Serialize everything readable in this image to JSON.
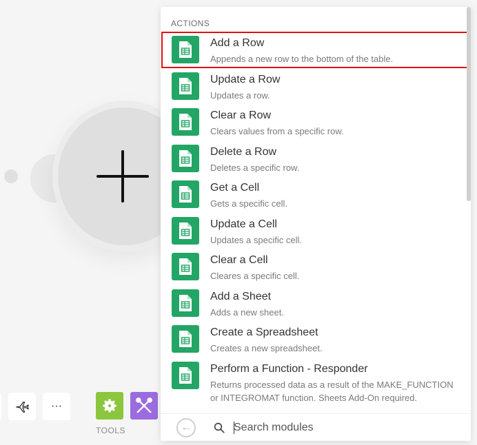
{
  "panel": {
    "section_title": "ACTIONS",
    "items": [
      {
        "title": "Add a Row",
        "desc": "Appends a new row to the bottom of the table."
      },
      {
        "title": "Update a Row",
        "desc": "Updates a row."
      },
      {
        "title": "Clear a Row",
        "desc": "Clears values from a specific row."
      },
      {
        "title": "Delete a Row",
        "desc": "Deletes a specific row."
      },
      {
        "title": "Get a Cell",
        "desc": "Gets a specific cell."
      },
      {
        "title": "Update a Cell",
        "desc": "Updates a specific cell."
      },
      {
        "title": "Clear a Cell",
        "desc": "Cleares a specific cell."
      },
      {
        "title": "Add a Sheet",
        "desc": "Adds a new sheet."
      },
      {
        "title": "Create a Spreadsheet",
        "desc": "Creates a new spreadsheet."
      },
      {
        "title": "Perform a Function - Responder",
        "desc": "Returns processed data as a result of the MAKE_FUNCTION or INTEGROMAT function. Sheets Add-On required."
      }
    ],
    "icon": "google-sheets-icon",
    "icon_color": "#23a566",
    "highlight_color": "#e01010"
  },
  "search": {
    "placeholder": "Search modules",
    "value": ""
  },
  "toolbar": {
    "more_label": "···",
    "tools_label": "TOOLS",
    "tools_color": "#8cc63e",
    "flow_color": "#9b6be0"
  }
}
